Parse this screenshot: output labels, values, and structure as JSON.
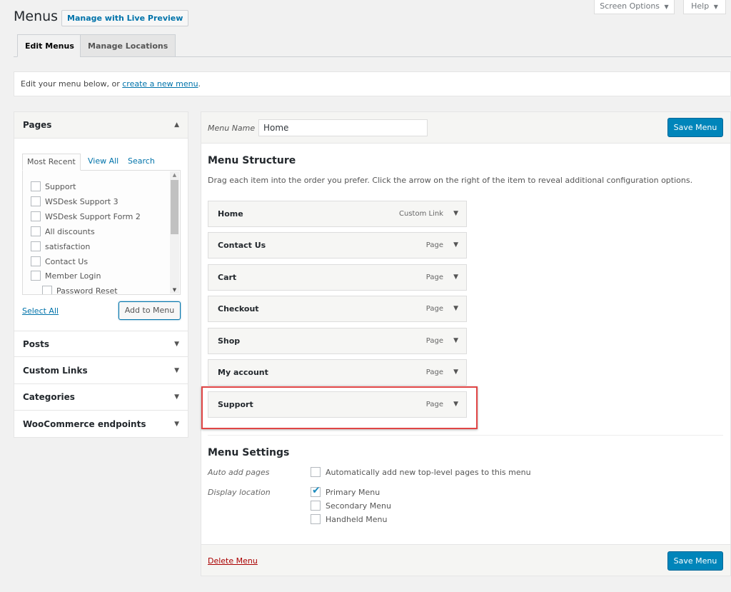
{
  "header": {
    "title": "Menus",
    "live_preview_label": "Manage with Live Preview",
    "screen_options_label": "Screen Options",
    "help_label": "Help",
    "dropdown_glyph": "▼"
  },
  "tabs": [
    {
      "label": "Edit Menus",
      "active": true
    },
    {
      "label": "Manage Locations",
      "active": false
    }
  ],
  "notice": {
    "prefix": "Edit your menu below, or ",
    "link": "create a new menu",
    "suffix": "."
  },
  "left_panel": {
    "pages": {
      "title": "Pages",
      "collapse_glyph": "▲",
      "inner_tabs": [
        "Most Recent",
        "View All",
        "Search"
      ],
      "items": [
        {
          "label": "Support",
          "checked": false,
          "indent": 0
        },
        {
          "label": "WSDesk Support 3",
          "checked": false,
          "indent": 0
        },
        {
          "label": "WSDesk Support Form 2",
          "checked": false,
          "indent": 0
        },
        {
          "label": "All discounts",
          "checked": false,
          "indent": 0
        },
        {
          "label": "satisfaction",
          "checked": false,
          "indent": 0
        },
        {
          "label": "Contact Us",
          "checked": false,
          "indent": 0
        },
        {
          "label": "Member Login",
          "checked": false,
          "indent": 0
        },
        {
          "label": "Password Reset",
          "checked": false,
          "indent": 1
        }
      ],
      "select_all_label": "Select All",
      "add_button_label": "Add to Menu"
    },
    "sections": [
      {
        "title": "Posts"
      },
      {
        "title": "Custom Links"
      },
      {
        "title": "Categories"
      },
      {
        "title": "WooCommerce endpoints"
      }
    ],
    "expand_glyph": "▼"
  },
  "right_panel": {
    "menu_name_label": "Menu Name",
    "menu_name_value": "Home",
    "save_label": "Save Menu",
    "structure_title": "Menu Structure",
    "structure_desc": "Drag each item into the order you prefer. Click the arrow on the right of the item to reveal additional configuration options.",
    "menu_items": [
      {
        "title": "Home",
        "type": "Custom Link"
      },
      {
        "title": "Contact Us",
        "type": "Page"
      },
      {
        "title": "Cart",
        "type": "Page"
      },
      {
        "title": "Checkout",
        "type": "Page"
      },
      {
        "title": "Shop",
        "type": "Page"
      },
      {
        "title": "My account",
        "type": "Page"
      },
      {
        "title": "Support",
        "type": "Page",
        "highlighted": true
      }
    ],
    "item_arrow_glyph": "▼",
    "settings_title": "Menu Settings",
    "auto_add_label": "Auto add pages",
    "auto_add_option": {
      "label": "Automatically add new top-level pages to this menu",
      "checked": false
    },
    "display_location_label": "Display location",
    "locations": [
      {
        "label": "Primary Menu",
        "checked": true
      },
      {
        "label": "Secondary Menu",
        "checked": false
      },
      {
        "label": "Handheld Menu",
        "checked": false
      }
    ],
    "check_glyph": "✔",
    "delete_label": "Delete Menu"
  },
  "colors": {
    "accent": "#0085ba",
    "link": "#0073aa",
    "delete": "#aa0000",
    "highlight_box": "#e04545"
  }
}
